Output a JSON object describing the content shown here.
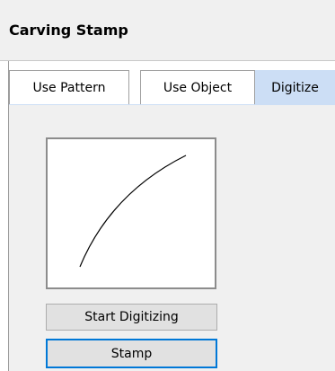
{
  "window": {
    "title": "Carving Stamp"
  },
  "tabs": [
    {
      "label": "Use Pattern",
      "active": false
    },
    {
      "label": "Use Object",
      "active": false
    },
    {
      "label": "Digitize",
      "active": true
    }
  ],
  "digitize": {
    "start_button_label": "Start Digitizing",
    "stamp_button_label": "Stamp"
  },
  "colors": {
    "active_tab": "#ccdef5",
    "panel_bg": "#f0f0f0",
    "default_button_border": "#0078d7"
  }
}
